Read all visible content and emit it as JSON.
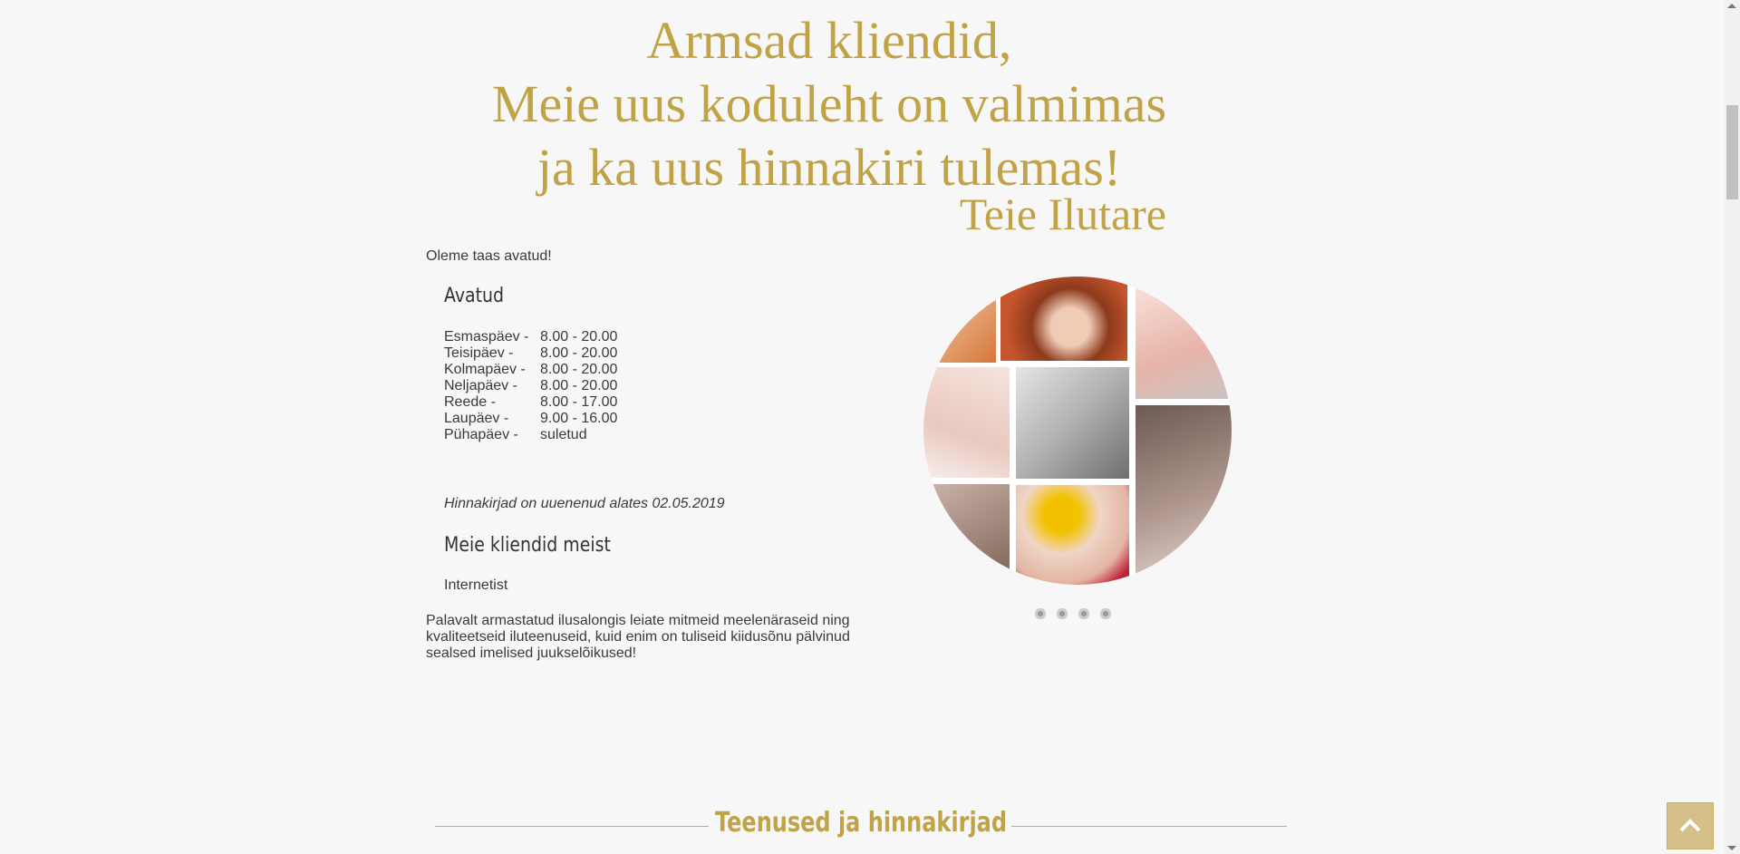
{
  "heading": {
    "line1": "Armsad kliendid,",
    "line2": "Meie uus koduleht on valmimas",
    "line3": "ja ka uus hinnakiri tulemas!",
    "signature": "Teie Ilutare"
  },
  "intro": "Oleme taas avatud!",
  "opening": {
    "title": "Avatud",
    "hours": [
      {
        "day": "Esmaspäev -",
        "time": "8.00 - 20.00"
      },
      {
        "day": "Teisipäev -",
        "time": "8.00 - 20.00"
      },
      {
        "day": "Kolmapäev -",
        "time": "8.00 - 20.00"
      },
      {
        "day": "Neljapäev -",
        "time": "8.00 - 20.00"
      },
      {
        "day": "Reede -",
        "time": "8.00 - 17.00"
      },
      {
        "day": "Laupäev -",
        "time": "9.00 - 16.00"
      },
      {
        "day": "Pühapäev -",
        "time": "suletud"
      }
    ]
  },
  "price_notice": "Hinnakirjad on uuenenud alates 02.05.2019",
  "reviews": {
    "title": "Meie kliendid meist",
    "source": "Internetist",
    "text": "Palavalt armastatud ilusalongis leiate mitmeid meeleпäraseid ning kvaliteetseid iluteenuseid, kuid enim on tuliseid kiidusõnu pälvinud sealsed imelised juukselõikused!"
  },
  "slider": {
    "dots": 4,
    "active": 0
  },
  "services_title": "Teenused ja hinnakirjad",
  "colors": {
    "gold": "#c0a247",
    "background": "#f8f7f7",
    "text": "#3a3a3a"
  },
  "icons": {
    "back_to_top": "chevron-up-icon"
  }
}
